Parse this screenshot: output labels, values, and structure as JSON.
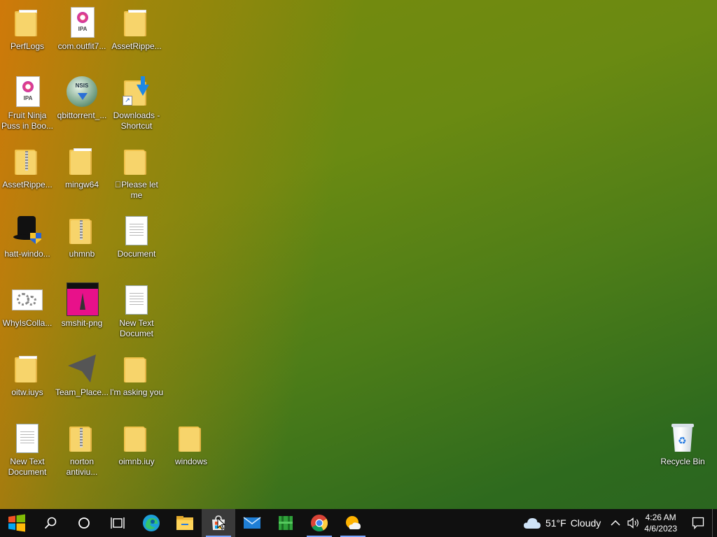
{
  "desktop": {
    "icons": [
      {
        "label": "PerfLogs"
      },
      {
        "label": "com.outfit7..."
      },
      {
        "label": "AssetRippe..."
      },
      {
        "label": "Fruit Ninja Puss in Boo..."
      },
      {
        "label": "qbittorrent_..."
      },
      {
        "label": "Downloads - Shortcut"
      },
      {
        "label": "AssetRippe..."
      },
      {
        "label": "mingw64"
      },
      {
        "label": "\u0000Please let me"
      },
      {
        "label": "hatt-windo..."
      },
      {
        "label": "uhmnb"
      },
      {
        "label": "Document"
      },
      {
        "label": "WhyIsColla..."
      },
      {
        "label": "smshit-png"
      },
      {
        "label": "New Text Documet"
      },
      {
        "label": "oitw.iuys"
      },
      {
        "label": "Team_Place..."
      },
      {
        "label": "I'm  asking you"
      },
      {
        "label": "New Text Document"
      },
      {
        "label": "norton antiviu..."
      },
      {
        "label": "oimnb.iuy"
      },
      {
        "label": "windows"
      },
      {
        "label": "Recycle Bin"
      }
    ],
    "ipa_tag": "IPA",
    "nsis_tag": "NSIS"
  },
  "taskbar": {
    "pinned": [
      "start",
      "search",
      "cortana",
      "task-view",
      "edge",
      "file-explorer",
      "microsoft-store",
      "mail",
      "minecraft",
      "chrome",
      "weather-app"
    ],
    "weather": {
      "temp": "51°F",
      "condition": "Cloudy"
    },
    "clock": {
      "time": "4:26 AM",
      "date": "4/6/2023"
    }
  },
  "colors": {
    "taskbar": "#101010",
    "folder": "#f7d46b",
    "accent": "#7aa7ff"
  }
}
